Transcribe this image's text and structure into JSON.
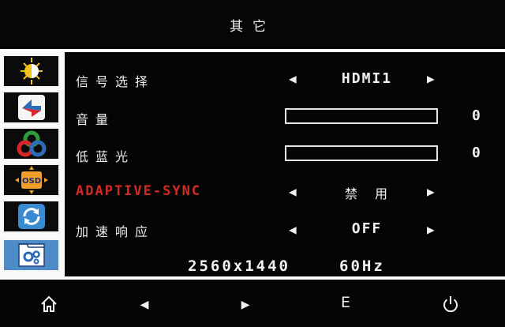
{
  "title": "其它",
  "sidebar": {
    "items": [
      {
        "name": "brightness-contrast-icon"
      },
      {
        "name": "image-settings-icon"
      },
      {
        "name": "color-icon"
      },
      {
        "name": "osd-icon"
      },
      {
        "name": "reset-icon"
      },
      {
        "name": "other-settings-icon"
      }
    ]
  },
  "rows": [
    {
      "label": "信号选择",
      "value": "HDMI1"
    },
    {
      "label": "音量",
      "value_num": "0",
      "level": 0
    },
    {
      "label": "低蓝光",
      "value_num": "0",
      "level": 0
    },
    {
      "label": "ADAPTIVE-SYNC",
      "value": "禁用"
    },
    {
      "label": "加速响应",
      "value": "OFF"
    }
  ],
  "footer": {
    "resolution": "2560x1440",
    "refresh": "60Hz"
  },
  "bottom_bar": {
    "enter_label": "E"
  },
  "colors": {
    "accent_red": "#d52a22",
    "active_sidebar": "#4d8cc6",
    "panel_white": "#fafafa"
  }
}
